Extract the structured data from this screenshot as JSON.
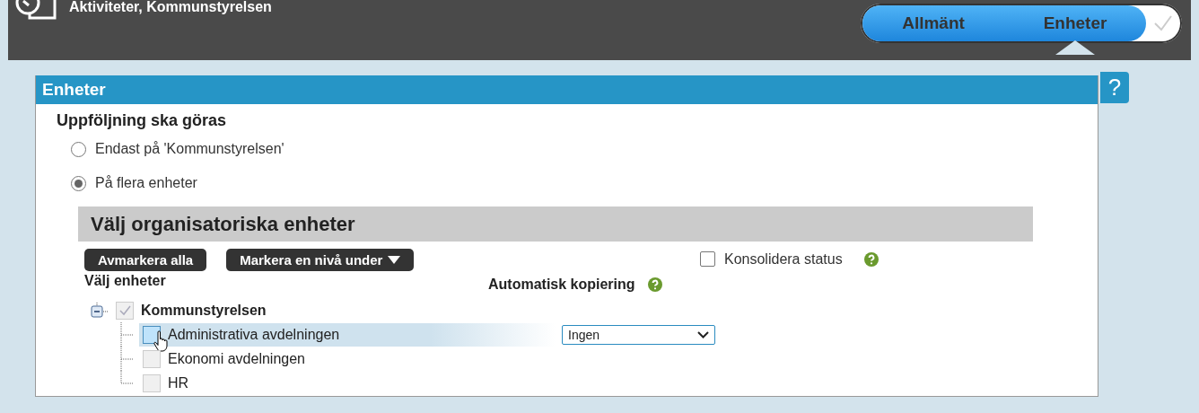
{
  "header": {
    "title": "Aktiviteter, Kommunstyrelsen"
  },
  "steps": [
    {
      "label": "Allmänt",
      "selected": false
    },
    {
      "label": "Enheter",
      "selected": true
    }
  ],
  "panel": {
    "title": "Enheter",
    "help": "?"
  },
  "followup": {
    "heading": "Uppföljning ska göras",
    "options": [
      {
        "label": "Endast på 'Kommunstyrelsen'",
        "selected": false
      },
      {
        "label": "På flera enheter",
        "selected": true
      }
    ]
  },
  "units": {
    "heading": "Välj organisatoriska enheter",
    "buttons": [
      {
        "label": "Avmarkera alla",
        "dropdown": false
      },
      {
        "label": "Markera en nivå under",
        "dropdown": true
      }
    ],
    "consolidate": {
      "label": "Konsolidera status",
      "checked": false
    },
    "tree_label": "Välj enheter",
    "copy_label": "Automatisk kopiering",
    "tree": [
      {
        "label": "Kommunstyrelsen",
        "checked": true,
        "expanded": true,
        "children": [
          {
            "label": "Administrativa avdelningen",
            "checked": false,
            "selected": true,
            "copy": "Ingen"
          },
          {
            "label": "Ekonomi avdelningen",
            "checked": false,
            "selected": false
          },
          {
            "label": "HR",
            "checked": false,
            "selected": false
          }
        ]
      }
    ]
  }
}
